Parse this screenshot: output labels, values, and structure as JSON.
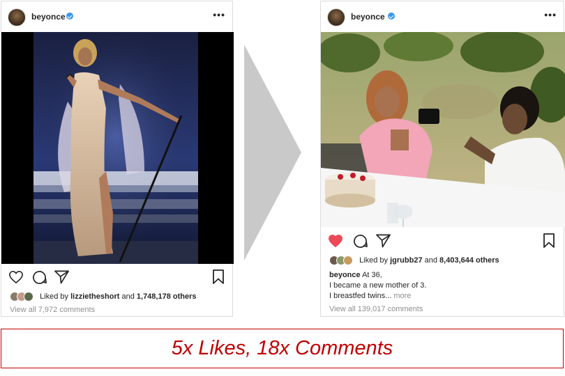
{
  "left_post": {
    "username": "beyonce",
    "verified_icon": "verified-badge-icon",
    "more_icon": "more-options-icon",
    "liked_by_prefix": "Liked by",
    "liked_by_user": "lizzietheshort",
    "liked_by_and": "and",
    "liked_by_count": "1,748,178 others",
    "view_all_comments": "View all 7,972 comments"
  },
  "right_post": {
    "username": "beyonce",
    "verified_icon": "verified-badge-icon",
    "more_icon": "more-options-icon",
    "liked": true,
    "liked_by_prefix": "Liked by",
    "liked_by_user": "jgrubb27",
    "liked_by_and": "and",
    "liked_by_count": "8,403,644 others",
    "caption_user": "beyonce",
    "caption_line1": "At 36,",
    "caption_line2": "I became a new mother of 3.",
    "caption_line3": "I breastfed twins...",
    "caption_more": "more",
    "view_all_comments": "View all 139,017 comments"
  },
  "summary": {
    "text": "5x Likes, 18x Comments"
  },
  "colors": {
    "accent_red": "#c00000",
    "heart_red": "#ed4956",
    "verified_blue": "#3897f0",
    "muted_gray": "#8e8e8e"
  }
}
